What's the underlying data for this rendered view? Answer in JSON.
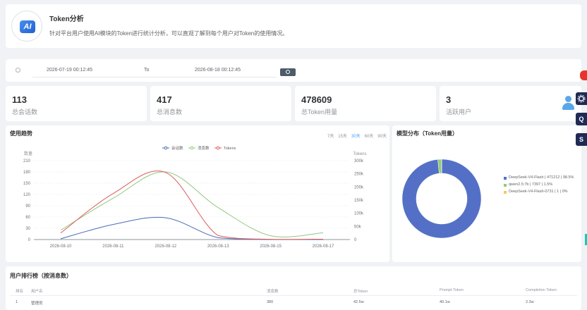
{
  "header": {
    "logo_text": "AI",
    "title": "Token分析",
    "description": "针对平台用户使用AI模块的Token进行统计分析，可以直观了解到每个用户对Token的使用情况。"
  },
  "filter": {
    "start": "2026-07-19 00:12:45",
    "to_label": "To",
    "end": "2026-08-18 00:12:45"
  },
  "stats": [
    {
      "value": "113",
      "label": "总会话数"
    },
    {
      "value": "417",
      "label": "总消息数"
    },
    {
      "value": "478609",
      "label": "总Token用量"
    },
    {
      "value": "3",
      "label": "活跃用户"
    }
  ],
  "trend": {
    "title": "使用趋势",
    "ranges": [
      "7天",
      "15天",
      "30天",
      "60天",
      "90天"
    ],
    "active_range": "30天"
  },
  "pie": {
    "title": "模型分布（Token用量）"
  },
  "ranking": {
    "title": "用户排行榜（按消息数）",
    "columns": [
      "排名",
      "用户名",
      "消息数",
      "总Token",
      "Prompt Token",
      "Completion Token"
    ],
    "rows": [
      [
        "1",
        "管理员",
        "380",
        "42.5w",
        "40.1w",
        "2.3w"
      ]
    ]
  },
  "sidebar_buttons": [
    "Q",
    "S"
  ],
  "colors": {
    "sessions": "#4a6bb7",
    "messages": "#91c77d",
    "tokens": "#e05a5a",
    "pie_main": "#5470c6",
    "pie_second": "#91cc75",
    "pie_third": "#fac858"
  },
  "chart_data": [
    {
      "type": "line",
      "x": [
        "2026-08-10",
        "2026-08-11",
        "2026-08-12",
        "2026-08-13",
        "2026-08-15",
        "2026-08-17"
      ],
      "ylabel": "数量",
      "ylabel_right": "Tokens",
      "ylim": [
        0,
        210
      ],
      "ylim_right": [
        0,
        300000
      ],
      "y_ticks": [
        0,
        30,
        60,
        90,
        120,
        150,
        180,
        210
      ],
      "y_right_ticks": [
        "0",
        "50k",
        "100k",
        "150k",
        "200k",
        "250k",
        "300k"
      ],
      "legend": "top-center",
      "series": [
        {
          "name": "会话数",
          "axis": "left",
          "values": [
            2,
            40,
            58,
            5,
            0,
            0
          ]
        },
        {
          "name": "消息数",
          "axis": "left",
          "values": [
            25,
            110,
            180,
            85,
            10,
            18
          ]
        },
        {
          "name": "Tokens",
          "axis": "right",
          "values": [
            25000,
            175000,
            255000,
            15000,
            1000,
            1500
          ]
        }
      ]
    },
    {
      "type": "pie",
      "legend": "right",
      "slices": [
        {
          "label": "DeepSeek-V4-Flash | 471212 | 98.5%",
          "value": 471212
        },
        {
          "label": "qwen2.5:7b | 7397 | 1.5%",
          "value": 7397
        },
        {
          "label": "DeepSeek-V4-Flash-0731 | 1 | 0%",
          "value": 1
        }
      ]
    }
  ]
}
